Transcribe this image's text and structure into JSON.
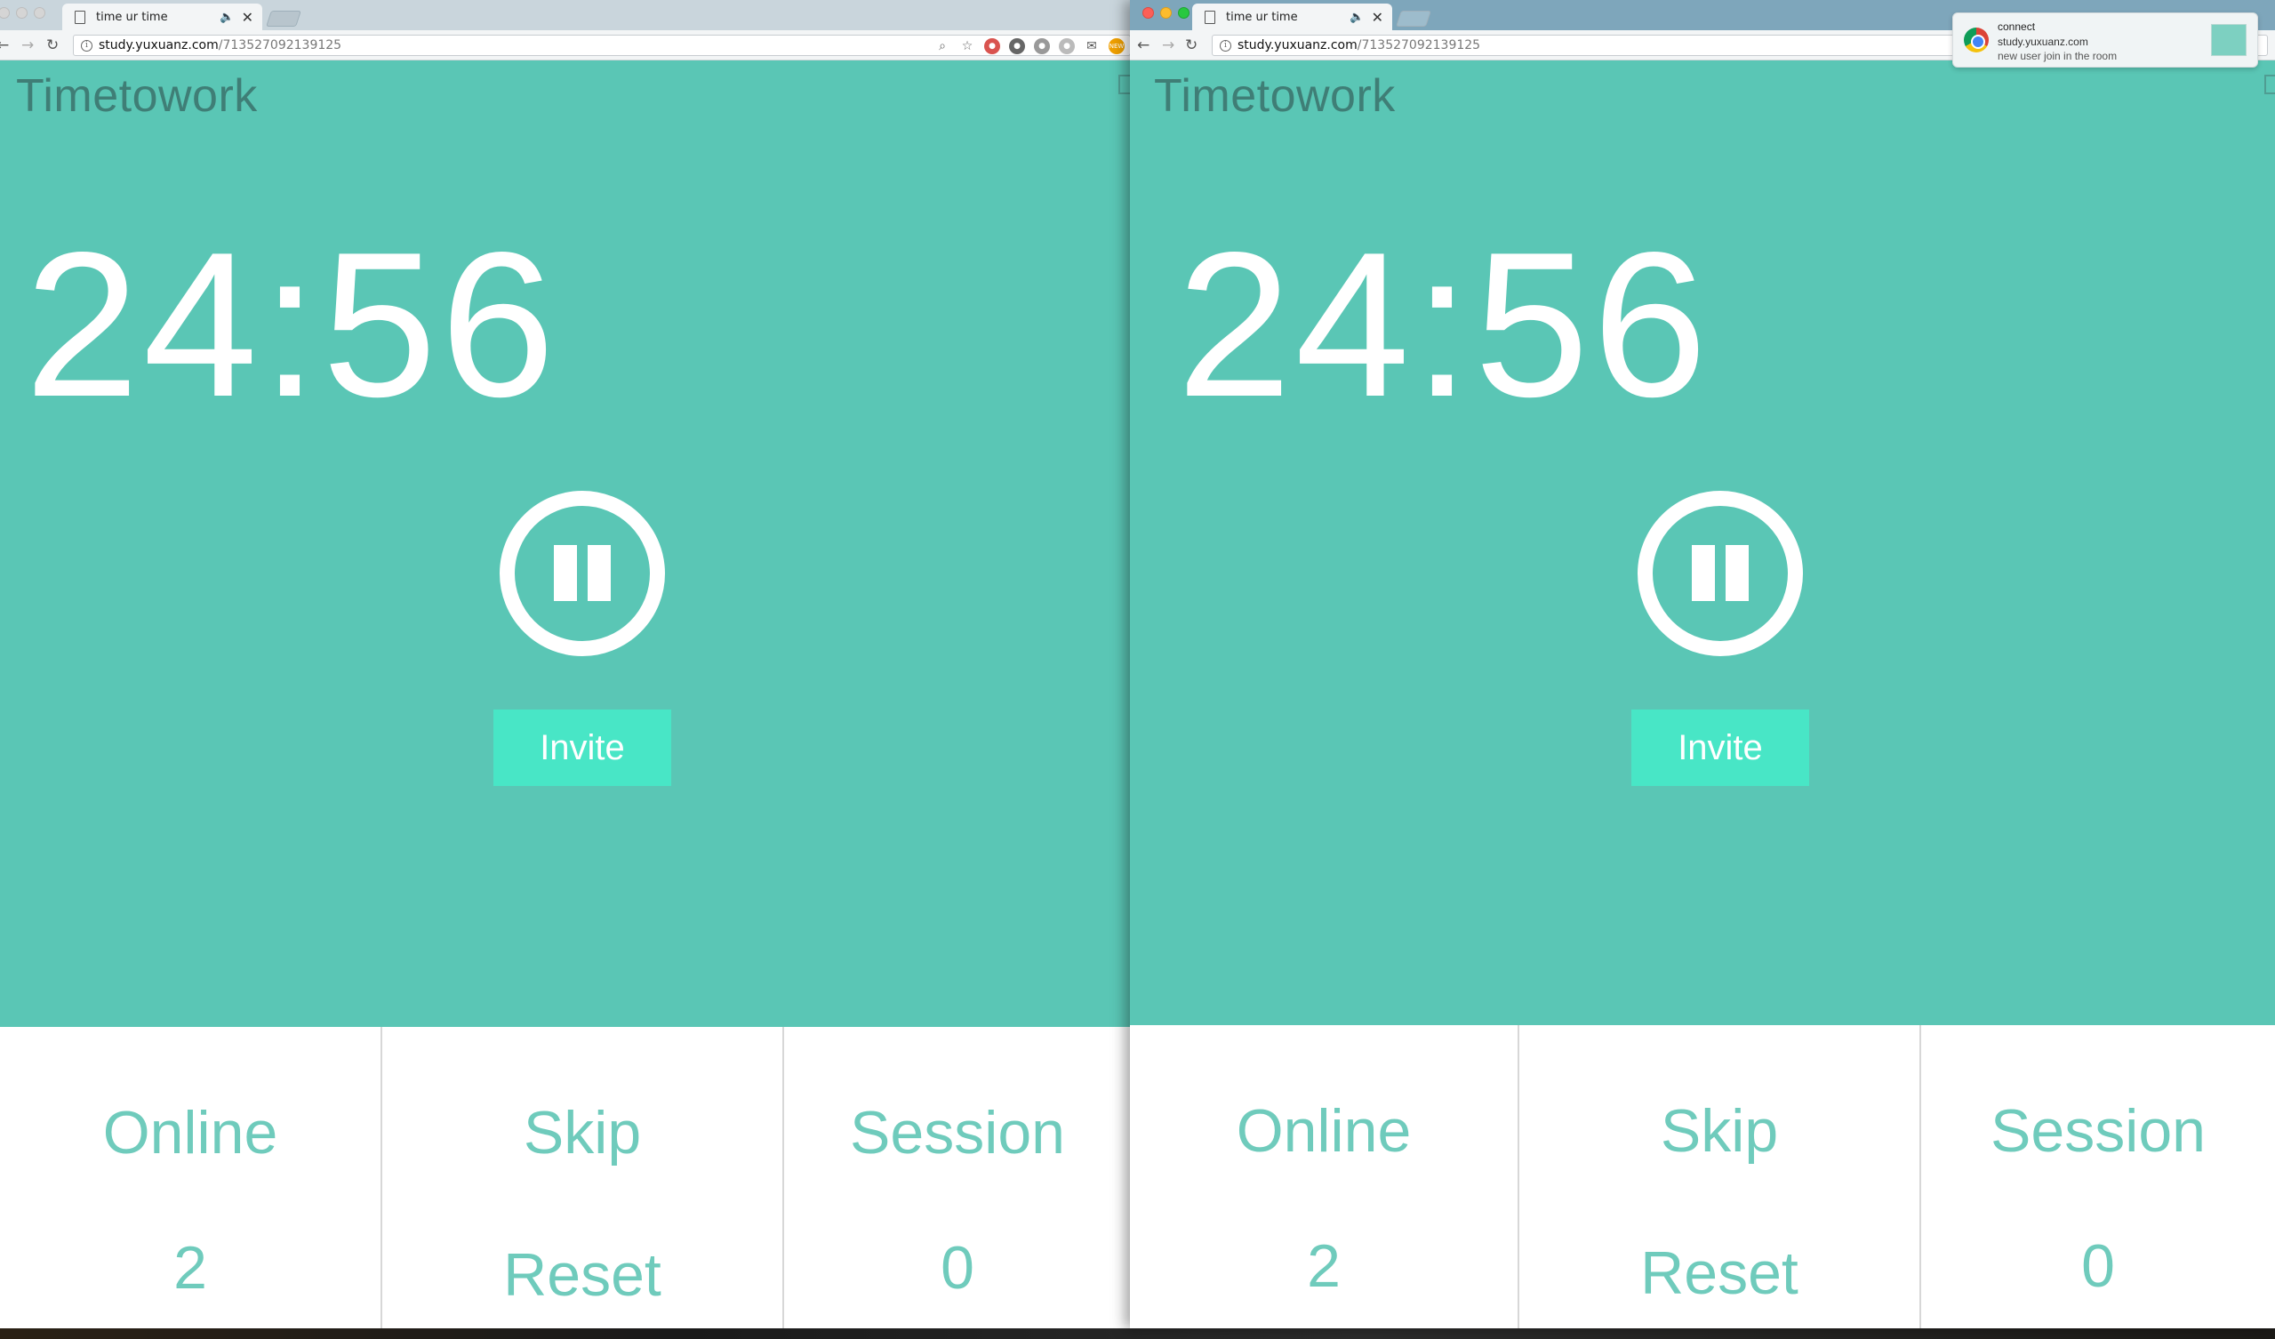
{
  "browser": {
    "tab_title": "time ur time",
    "tab_audio": "🔈",
    "tab_close": "✕",
    "url_host": "study.yuxuanz.com",
    "url_path": "/713527092139125",
    "back": "←",
    "forward": "→",
    "reload": "↻",
    "info": "i",
    "ext_badge": "NEW"
  },
  "app": {
    "brand": "Timetowork",
    "timer": "24:56",
    "invite_label": "Invite",
    "online_label": "Online",
    "online_count": "2",
    "skip_label": "Skip",
    "reset_label": "Reset",
    "session_label": "Session",
    "session_count": "0"
  },
  "notification": {
    "title": "connect",
    "site": "study.yuxuanz.com",
    "message": "new user join in the room"
  },
  "colors": {
    "background": "#5ac6b5",
    "invite": "#48e6c6",
    "brand_text": "#3f7e76",
    "stat_text": "#6fcbbc"
  }
}
